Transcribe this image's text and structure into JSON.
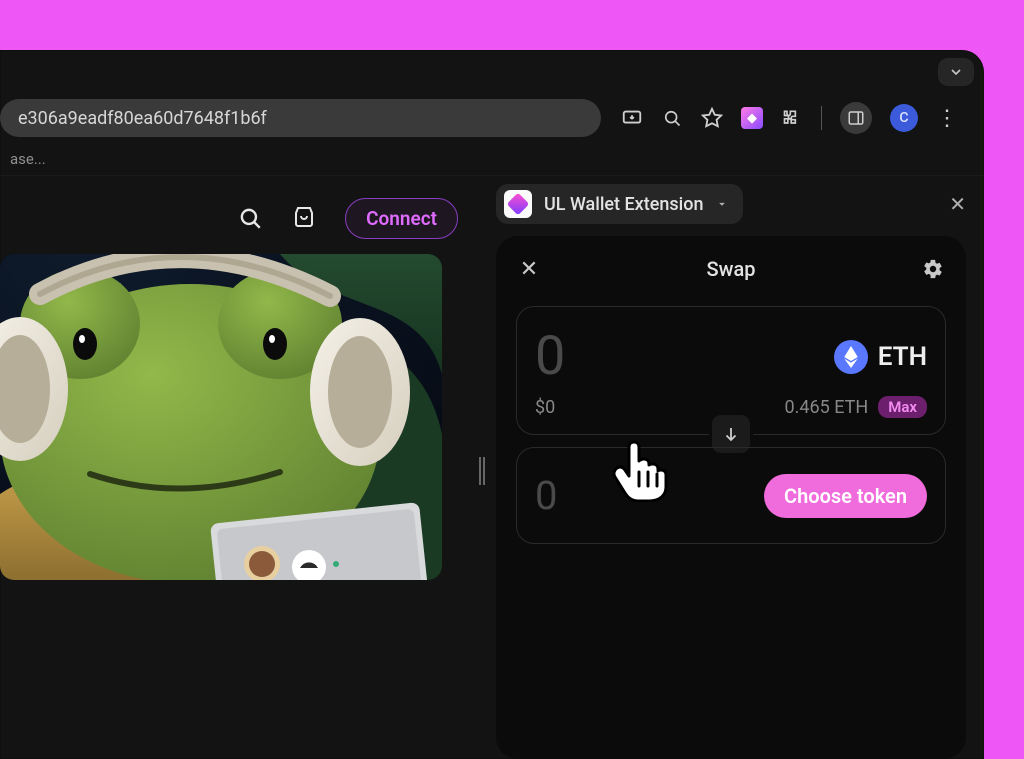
{
  "browser": {
    "url_fragment": "e306a9eadf80ea60d7648f1b6f",
    "bookmarks_hint": "ase...",
    "avatar_initial": "C"
  },
  "app": {
    "connect_label": "Connect"
  },
  "extension": {
    "name": "UL Wallet Extension"
  },
  "wallet": {
    "title": "Swap",
    "from": {
      "amount": "0",
      "fiat": "$0",
      "token_symbol": "ETH",
      "balance": "0.465 ETH",
      "max_label": "Max"
    },
    "to": {
      "amount": "0",
      "choose_label": "Choose token"
    }
  }
}
